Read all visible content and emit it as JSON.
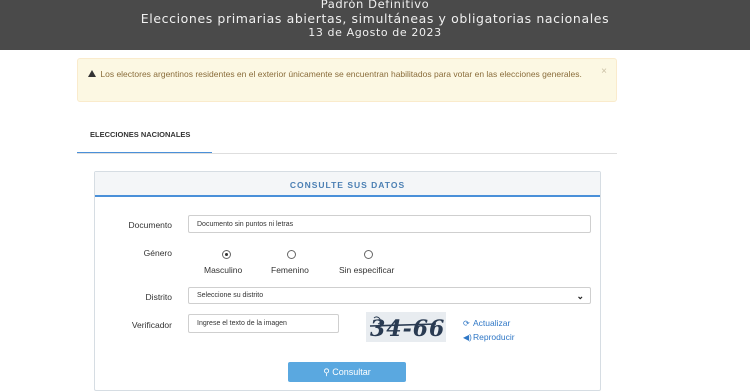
{
  "header": {
    "line1": "Padrón Definitivo",
    "line2": "Elecciones primarias abiertas, simultáneas y obligatorias nacionales",
    "line3": "13 de Agosto de 2023"
  },
  "alert": {
    "text": "Los electores argentinos residentes en el exterior únicamente se encuentran habilitados para votar en las elecciones generales.",
    "close": "×"
  },
  "tabs": [
    {
      "label": "ELECCIONES NACIONALES"
    }
  ],
  "panel": {
    "title": "CONSULTE SUS DATOS",
    "documento": {
      "label": "Documento",
      "placeholder": "Documento sin puntos ni letras"
    },
    "genero": {
      "label": "Género",
      "options": [
        {
          "label": "Masculino",
          "selected": true
        },
        {
          "label": "Femenino",
          "selected": false
        },
        {
          "label": "Sin especificar",
          "selected": false
        }
      ]
    },
    "distrito": {
      "label": "Distrito",
      "value": "Seleccione su distrito"
    },
    "verificador": {
      "label": "Verificador",
      "placeholder": "Ingrese el texto de la imagen",
      "captcha_text": "34-66"
    },
    "actualizar": "Actualizar",
    "reproducir": "Reproducir",
    "consultar": "Consultar"
  },
  "colors": {
    "header_bg": "#4a4a4a",
    "accent": "#4a90d9",
    "button": "#5aa8e0",
    "alert_bg": "#fcf8e3",
    "link": "#2f77c6"
  }
}
